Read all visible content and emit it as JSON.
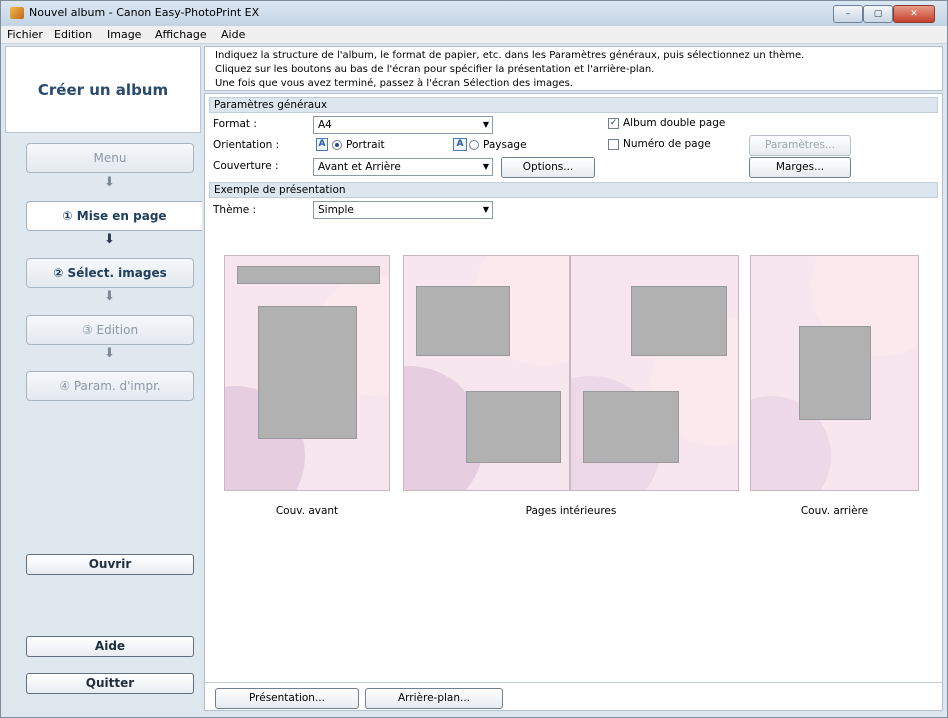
{
  "window": {
    "title": "Nouvel album - Canon Easy-PhotoPrint EX",
    "controls": [
      "–",
      "▢",
      "✕"
    ]
  },
  "menu": [
    "Fichier",
    "Edition",
    "Image",
    "Affichage",
    "Aide"
  ],
  "sidebar": {
    "heading": "Créer un album",
    "menu_label": "Menu",
    "steps": [
      {
        "label": "① Mise en page"
      },
      {
        "label": "② Sélect. images"
      },
      {
        "label": "③ Edition"
      },
      {
        "label": "④ Param. d'impr."
      }
    ],
    "open_label": "Ouvrir",
    "help_label": "Aide",
    "quit_label": "Quitter"
  },
  "instructions": [
    "Indiquez la structure de l'album, le format de papier, etc. dans les Paramètres généraux, puis sélectionnez un thème.",
    "Cliquez sur les boutons au bas de l'écran pour spécifier la présentation et l'arrière-plan.",
    "Une fois que vous avez terminé, passez à l'écran Sélection des images."
  ],
  "general": {
    "header": "Paramètres généraux",
    "format_label": "Format :",
    "format_value": "A4",
    "orientation_label": "Orientation :",
    "portrait_label": "Portrait",
    "landscape_label": "Paysage",
    "cover_label": "Couverture :",
    "cover_value": "Avant et Arrière",
    "options_label": "Options...",
    "double_page_label": "Album double page",
    "double_page_checked": true,
    "page_number_label": "Numéro de page",
    "page_number_checked": false,
    "settings_label": "Paramètres...",
    "margins_label": "Marges..."
  },
  "preview": {
    "header": "Exemple de présentation",
    "theme_label": "Thème :",
    "theme_value": "Simple",
    "front_caption": "Couv. avant",
    "inner_caption": "Pages intérieures",
    "back_caption": "Couv. arrière"
  },
  "bottom": {
    "layout_label": "Présentation...",
    "background_label": "Arrière-plan..."
  },
  "colors": {
    "accent": "#1f3d5c",
    "page_bg": "#f7e6ee",
    "placeholder": "#b1b1b1"
  }
}
